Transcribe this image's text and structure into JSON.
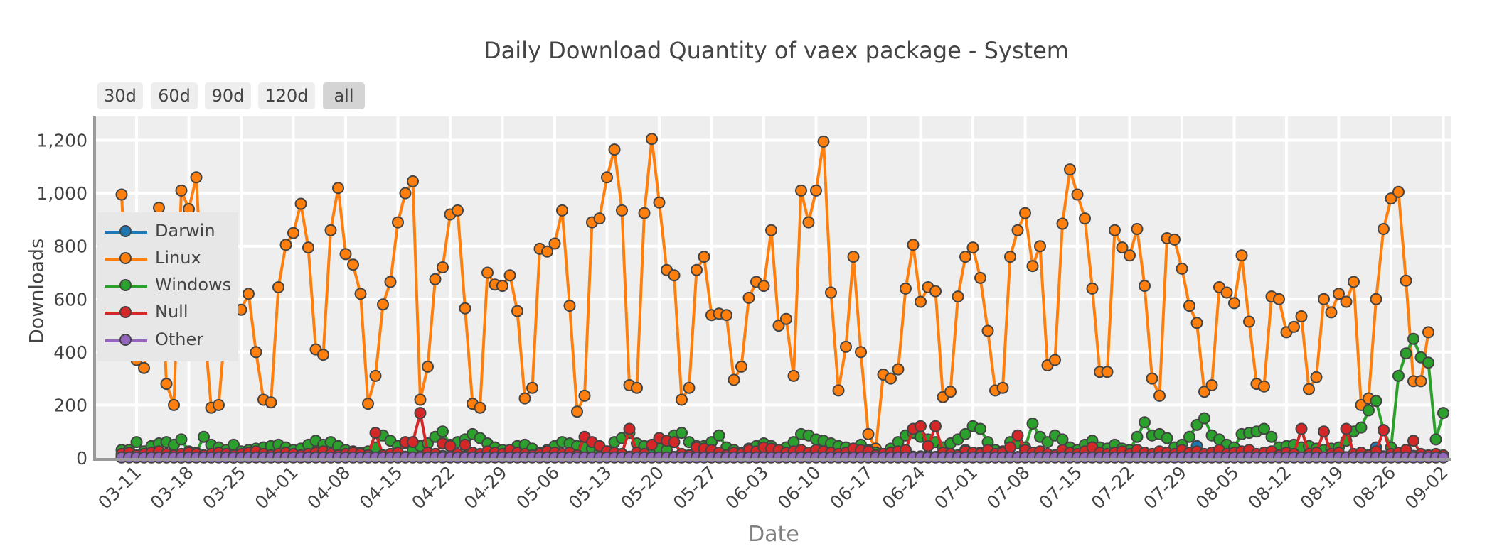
{
  "range_buttons": [
    {
      "label": "30d",
      "active": false
    },
    {
      "label": "60d",
      "active": false
    },
    {
      "label": "90d",
      "active": false
    },
    {
      "label": "120d",
      "active": false
    },
    {
      "label": "all",
      "active": true
    }
  ],
  "chart_data": {
    "type": "line",
    "title": "Daily Download Quantity of vaex package - System",
    "xlabel": "Date",
    "ylabel": "Downloads",
    "ylim": [
      0,
      1290
    ],
    "yticks": [
      0,
      200,
      400,
      600,
      800,
      1000,
      1200
    ],
    "ytick_labels": [
      "0",
      "200",
      "400",
      "600",
      "800",
      "1,000",
      "1,200"
    ],
    "x_start": "03-09",
    "x_end": "09-02",
    "xtick_labels": [
      "03-11",
      "03-18",
      "03-25",
      "04-01",
      "04-08",
      "04-15",
      "04-22",
      "04-29",
      "05-06",
      "05-13",
      "05-20",
      "05-27",
      "06-03",
      "06-10",
      "06-17",
      "06-24",
      "07-01",
      "07-08",
      "07-15",
      "07-22",
      "07-29",
      "08-05",
      "08-12",
      "08-19",
      "08-26",
      "09-02"
    ],
    "grid": true,
    "legend_position": "left",
    "markers": true,
    "series": [
      {
        "name": "Darwin",
        "color": "#1f77b4",
        "values": [
          5,
          3,
          4,
          6,
          3,
          5,
          4,
          3,
          2,
          4,
          5,
          3,
          4,
          6,
          3,
          2,
          4,
          3,
          5,
          4,
          3,
          6,
          10,
          4,
          3,
          5,
          4,
          3,
          4,
          5,
          3,
          4,
          3,
          2,
          4,
          6,
          3,
          4,
          5,
          3,
          4,
          3,
          5,
          8,
          4,
          3,
          6,
          4,
          3,
          5,
          12,
          4,
          3,
          5,
          4,
          3,
          6,
          4,
          3,
          5,
          4,
          3,
          4,
          5,
          3,
          6,
          4,
          3,
          5,
          20,
          4,
          3,
          5,
          6,
          4,
          3,
          5,
          4,
          3,
          6,
          12,
          38,
          4,
          3,
          5,
          4,
          3,
          6,
          4,
          3,
          5,
          4,
          6,
          3,
          5,
          4,
          3,
          8,
          4,
          3,
          5,
          4,
          3,
          6,
          4,
          3,
          5,
          6,
          10,
          4,
          3,
          5,
          4,
          30,
          8,
          20,
          12,
          4,
          3,
          5,
          4,
          3,
          6,
          4,
          3,
          5,
          4,
          6,
          3,
          5,
          8,
          4,
          3,
          5,
          4,
          3,
          6,
          20,
          4,
          3,
          5,
          4,
          3,
          6,
          45,
          4,
          3,
          5,
          4,
          3,
          6,
          4,
          3,
          5,
          4,
          3,
          6,
          4,
          3,
          5,
          4,
          3,
          6,
          4,
          3,
          5,
          4,
          3,
          40,
          6,
          4,
          3,
          5,
          8,
          4,
          3,
          6,
          4
        ]
      },
      {
        "name": "Linux",
        "color": "#ff7f0e",
        "values": [
          995,
          420,
          370,
          340,
          520,
          945,
          280,
          200,
          1010,
          940,
          1060,
          520,
          190,
          200,
          530,
          560,
          560,
          620,
          400,
          220,
          210,
          645,
          805,
          850,
          960,
          795,
          410,
          390,
          860,
          1020,
          770,
          730,
          620,
          205,
          310,
          580,
          665,
          890,
          1000,
          1045,
          220,
          345,
          675,
          720,
          920,
          935,
          565,
          205,
          190,
          700,
          655,
          650,
          690,
          555,
          225,
          265,
          790,
          780,
          810,
          935,
          575,
          175,
          235,
          890,
          905,
          1060,
          1165,
          935,
          275,
          265,
          925,
          1205,
          965,
          710,
          690,
          220,
          265,
          710,
          760,
          540,
          545,
          540,
          295,
          345,
          605,
          665,
          650,
          860,
          500,
          525,
          310,
          1010,
          890,
          1010,
          1195,
          625,
          255,
          420,
          760,
          400,
          90,
          35,
          315,
          300,
          335,
          640,
          805,
          590,
          645,
          630,
          230,
          250,
          610,
          760,
          795,
          680,
          480,
          255,
          265,
          760,
          860,
          925,
          725,
          800,
          350,
          370,
          885,
          1090,
          995,
          905,
          640,
          325,
          325,
          860,
          795,
          765,
          865,
          650,
          300,
          235,
          830,
          825,
          715,
          575,
          510,
          250,
          275,
          645,
          625,
          585,
          765,
          515,
          280,
          270,
          610,
          600,
          475,
          495,
          535,
          260,
          305,
          600,
          550,
          620,
          590,
          665,
          200,
          225,
          600,
          865,
          980,
          1005,
          670,
          290,
          290,
          475
        ]
      },
      {
        "name": "Windows",
        "color": "#2ca02c",
        "values": [
          30,
          30,
          60,
          25,
          45,
          55,
          60,
          50,
          70,
          25,
          20,
          80,
          50,
          40,
          30,
          50,
          25,
          30,
          35,
          40,
          45,
          50,
          40,
          30,
          35,
          50,
          65,
          50,
          60,
          45,
          30,
          25,
          20,
          25,
          40,
          85,
          65,
          45,
          55,
          30,
          45,
          55,
          80,
          100,
          50,
          60,
          70,
          90,
          75,
          55,
          40,
          30,
          25,
          45,
          50,
          35,
          20,
          30,
          45,
          60,
          55,
          45,
          40,
          35,
          20,
          25,
          60,
          75,
          95,
          55,
          45,
          40,
          35,
          30,
          85,
          95,
          60,
          45,
          45,
          60,
          85,
          40,
          30,
          20,
          35,
          45,
          55,
          45,
          30,
          40,
          60,
          90,
          85,
          70,
          65,
          55,
          45,
          40,
          35,
          50,
          30,
          20,
          15,
          35,
          60,
          85,
          95,
          80,
          70,
          60,
          40,
          55,
          70,
          90,
          120,
          110,
          60,
          30,
          25,
          60,
          55,
          40,
          130,
          80,
          60,
          85,
          70,
          40,
          30,
          50,
          65,
          40,
          35,
          50,
          35,
          30,
          80,
          135,
          85,
          90,
          75,
          40,
          50,
          80,
          125,
          150,
          85,
          70,
          50,
          40,
          90,
          95,
          100,
          110,
          80,
          40,
          45,
          50,
          40,
          45,
          35,
          30,
          35,
          40,
          65,
          100,
          115,
          180,
          215,
          105,
          40,
          310,
          395,
          450,
          380,
          360,
          70,
          170
        ]
      },
      {
        "name": "Null",
        "color": "#d62728",
        "values": [
          15,
          20,
          10,
          15,
          20,
          25,
          15,
          10,
          15,
          20,
          15,
          10,
          15,
          20,
          15,
          10,
          15,
          20,
          25,
          15,
          10,
          15,
          20,
          15,
          10,
          15,
          20,
          25,
          15,
          10,
          15,
          20,
          15,
          10,
          95,
          10,
          15,
          20,
          60,
          60,
          170,
          20,
          15,
          55,
          45,
          15,
          50,
          20,
          15,
          25,
          20,
          15,
          30,
          20,
          15,
          10,
          15,
          25,
          20,
          15,
          20,
          10,
          80,
          60,
          45,
          25,
          20,
          15,
          110,
          20,
          15,
          50,
          75,
          65,
          60,
          15,
          10,
          40,
          35,
          30,
          20,
          10,
          20,
          15,
          30,
          25,
          40,
          35,
          30,
          20,
          25,
          30,
          20,
          30,
          25,
          20,
          15,
          20,
          35,
          30,
          25,
          10,
          15,
          20,
          25,
          30,
          110,
          120,
          45,
          120,
          20,
          15,
          10,
          25,
          20,
          15,
          30,
          15,
          20,
          40,
          85,
          30,
          20,
          25,
          15,
          10,
          30,
          20,
          15,
          25,
          40,
          20,
          15,
          20,
          25,
          15,
          30,
          20,
          15,
          25,
          20,
          15,
          30,
          20,
          25,
          15,
          20,
          30,
          15,
          20,
          25,
          30,
          15,
          20,
          25,
          10,
          20,
          15,
          110,
          15,
          20,
          100,
          15,
          20,
          110,
          15,
          20,
          10,
          25,
          105,
          15,
          20,
          30,
          65,
          15,
          10,
          15,
          10
        ]
      },
      {
        "name": "Other",
        "color": "#9467bd",
        "values": [
          2,
          2,
          2,
          2,
          2,
          2,
          2,
          2,
          2,
          2,
          2,
          2,
          2,
          2,
          2,
          2,
          2,
          2,
          2,
          2,
          2,
          2,
          2,
          2,
          2,
          2,
          2,
          2,
          2,
          2,
          2,
          2,
          2,
          2,
          2,
          2,
          2,
          2,
          2,
          2,
          2,
          2,
          2,
          2,
          2,
          2,
          2,
          2,
          2,
          2,
          2,
          2,
          2,
          2,
          2,
          2,
          2,
          2,
          2,
          2,
          2,
          2,
          2,
          2,
          2,
          2,
          2,
          2,
          2,
          2,
          2,
          2,
          2,
          2,
          2,
          2,
          2,
          2,
          2,
          2,
          2,
          2,
          2,
          2,
          2,
          2,
          2,
          2,
          2,
          2,
          2,
          2,
          2,
          2,
          2,
          2,
          2,
          2,
          2,
          2,
          2,
          2,
          2,
          2,
          2,
          2,
          2,
          2,
          2,
          2,
          2,
          2,
          2,
          2,
          2,
          2,
          2,
          2,
          2,
          2,
          2,
          2,
          2,
          2,
          2,
          2,
          2,
          2,
          2,
          2,
          2,
          2,
          2,
          2,
          2,
          2,
          2,
          2,
          2,
          2,
          2,
          2,
          2,
          2,
          2,
          2,
          2,
          2,
          2,
          2,
          2,
          2,
          2,
          2,
          2,
          2,
          2,
          2,
          2,
          2,
          2,
          2,
          2,
          2,
          2,
          2,
          2,
          2,
          2,
          2,
          2,
          2,
          2,
          2,
          2,
          2,
          2,
          2
        ]
      }
    ]
  }
}
